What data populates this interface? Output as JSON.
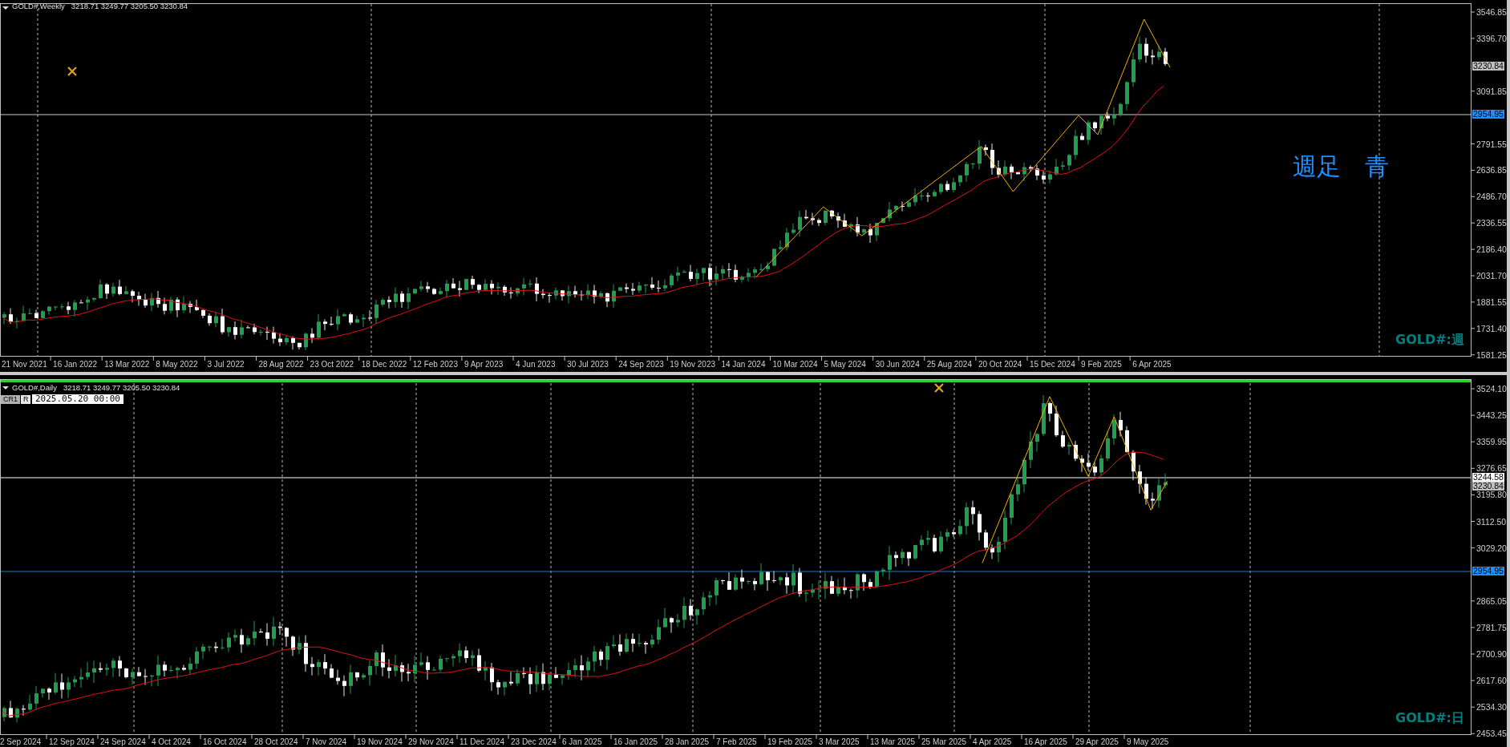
{
  "top_panel": {
    "header": {
      "symbol": "GOLD#,Weekly",
      "ohlc": "3218.71 3249.77 3205.50 3230.84"
    },
    "annotation": "週足　青",
    "watermark_label": "GOLD#:週",
    "price_ticks": [
      "3546.85",
      "3396.70",
      "3091.85",
      "2791.55",
      "2636.85",
      "2486.70",
      "2336.55",
      "2186.40",
      "2031.70",
      "1881.55",
      "1731.40",
      "1581.25"
    ],
    "price_markers": [
      {
        "kind": "bid",
        "text": "3230.84"
      },
      {
        "kind": "level",
        "text": "2954.95"
      }
    ],
    "time_labels": [
      "21 Nov 2021",
      "16 Jan 2022",
      "13 Mar 2022",
      "8 May 2022",
      "3 Jul 2022",
      "28 Aug 2022",
      "23 Oct 2022",
      "18 Dec 2022",
      "12 Feb 2023",
      "9 Apr 2023",
      "4 Jun 2023",
      "30 Jul 2023",
      "24 Sep 2023",
      "19 Nov 2023",
      "14 Jan 2024",
      "10 Mar 2024",
      "5 May 2024",
      "30 Jun 2024",
      "25 Aug 2024",
      "20 Oct 2024",
      "15 Dec 2024",
      "9 Feb 2025",
      "6 Apr 2025"
    ]
  },
  "bottom_panel": {
    "header": {
      "symbol": "GOLD#,Daily",
      "ohlc": "3218.71 3249.77 3205.50 3230.84"
    },
    "toolbar": {
      "buttons": [
        "CR1",
        "R"
      ],
      "time_field": "2025.05.20 00:00"
    },
    "watermark_label": "GOLD#:日",
    "price_ticks": [
      "3524.10",
      "3443.25",
      "3359.95",
      "3276.65",
      "3195.80",
      "3112.50",
      "3029.20",
      "2865.05",
      "2781.75",
      "2700.90",
      "2617.60",
      "2534.30",
      "2453.45"
    ],
    "price_markers": [
      {
        "kind": "line",
        "text": "3244.58"
      },
      {
        "kind": "bid",
        "text": "3230.84"
      },
      {
        "kind": "level",
        "text": "2954.95"
      }
    ],
    "time_labels": [
      "2 Sep 2024",
      "12 Sep 2024",
      "24 Sep 2024",
      "4 Oct 2024",
      "16 Oct 2024",
      "28 Oct 2024",
      "7 Nov 2024",
      "19 Nov 2024",
      "29 Nov 2024",
      "11 Dec 2024",
      "23 Dec 2024",
      "6 Jan 2025",
      "16 Jan 2025",
      "28 Jan 2025",
      "7 Feb 2025",
      "19 Feb 2025",
      "3 Mar 2025",
      "13 Mar 2025",
      "25 Mar 2025",
      "4 Apr 2025",
      "16 Apr 2025",
      "29 Apr 2025",
      "9 May 2025"
    ]
  }
}
